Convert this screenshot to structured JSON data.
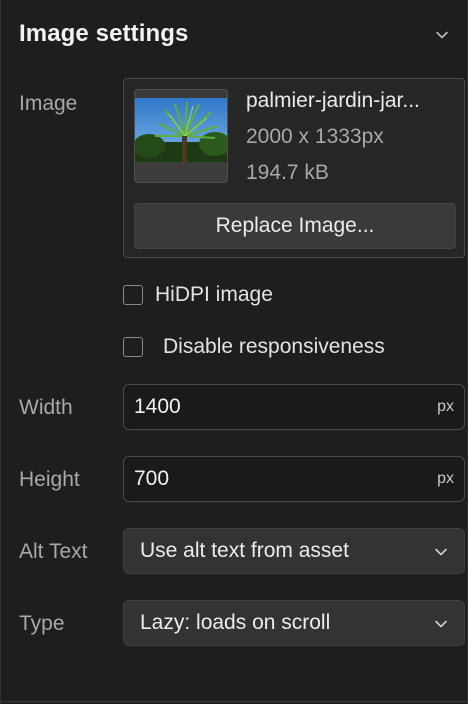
{
  "header": {
    "title": "Image settings",
    "chevron_icon": "chevron-down-icon"
  },
  "image": {
    "label": "Image",
    "file_name": "palmier-jardin-jar...",
    "dimensions": "2000 x 1333px",
    "file_size": "194.7 kB",
    "thumbnail_icon": "palm-tree-photo",
    "replace_label": "Replace Image..."
  },
  "options": {
    "hidpi_label": "HiDPI image",
    "hidpi_checked": false,
    "disable_responsive_label": "Disable responsiveness",
    "disable_responsive_checked": false
  },
  "width": {
    "label": "Width",
    "value": "1400",
    "unit": "px"
  },
  "height": {
    "label": "Height",
    "value": "700",
    "unit": "px"
  },
  "alt_text": {
    "label": "Alt Text",
    "selected": "Use alt text from asset"
  },
  "type": {
    "label": "Type",
    "selected": "Lazy: loads on scroll"
  },
  "colors": {
    "background": "#1e1e1e",
    "input_background": "#1a1a1a",
    "select_background": "#333333",
    "text_primary": "#f0f0f0",
    "text_secondary": "#a8a8a8"
  }
}
